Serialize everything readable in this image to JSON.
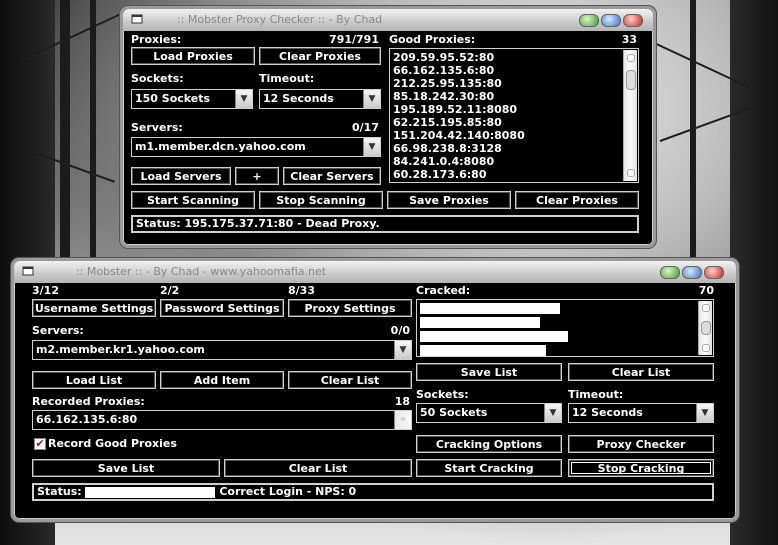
{
  "checker": {
    "title": ":: Mobster Proxy Checker :: - By Chad",
    "proxies_label": "Proxies:",
    "proxies_count": "791/791",
    "load_proxies": "Load Proxies",
    "clear_proxies": "Clear Proxies",
    "sockets_label": "Sockets:",
    "sockets_value": "150 Sockets",
    "timeout_label": "Timeout:",
    "timeout_value": "12 Seconds",
    "servers_label": "Servers:",
    "servers_count": "0/17",
    "server_value": "m1.member.dcn.yahoo.com",
    "load_servers": "Load Servers",
    "plus": "+",
    "clear_servers": "Clear Servers",
    "start_scanning": "Start Scanning",
    "stop_scanning": "Stop Scanning",
    "save_proxies": "Save Proxies",
    "clear_proxies_2": "Clear Proxies",
    "good_label": "Good Proxies:",
    "good_count": "33",
    "good_list": [
      "209.59.95.52:80",
      "66.162.135.6:80",
      "212.25.95.135:80",
      "85.18.242.30:80",
      "195.189.52.11:8080",
      "62.215.195.85:80",
      "151.204.42.140:8080",
      "66.98.238.8:3128",
      "84.241.0.4:8080",
      "60.28.173.6:80"
    ],
    "status": "Status: 195.175.37.71:80 - Dead Proxy."
  },
  "mobster": {
    "title": ":: Mobster :: - By Chad - www.yahoomafia.net",
    "user_count": "3/12",
    "pass_count": "2/2",
    "proxy_count": "8/33",
    "username_settings": "Username Settings",
    "password_settings": "Password Settings",
    "proxy_settings": "Proxy Settings",
    "servers_label": "Servers:",
    "servers_count": "0/0",
    "server_value": "m2.member.kr1.yahoo.com",
    "load_list": "Load List",
    "add_item": "Add Item",
    "clear_list": "Clear List",
    "recorded_label": "Recorded Proxies:",
    "recorded_count": "18",
    "recorded_value": "66.162.135.6:80",
    "record_good": "Record Good Proxies",
    "record_checked": true,
    "save_list": "Save List",
    "clear_list_2": "Clear List",
    "cracked_label": "Cracked:",
    "cracked_count": "70",
    "save_list_2": "Save List",
    "clear_list_3": "Clear List",
    "sockets_label": "Sockets:",
    "sockets_value": "50 Sockets",
    "timeout_label": "Timeout:",
    "timeout_value": "12 Seconds",
    "cracking_options": "Cracking Options",
    "proxy_checker": "Proxy Checker",
    "start_cracking": "Start Cracking",
    "stop_cracking": "Stop Cracking",
    "status_prefix": "Status:",
    "status_suffix": "Correct Login - NPS: 0"
  }
}
